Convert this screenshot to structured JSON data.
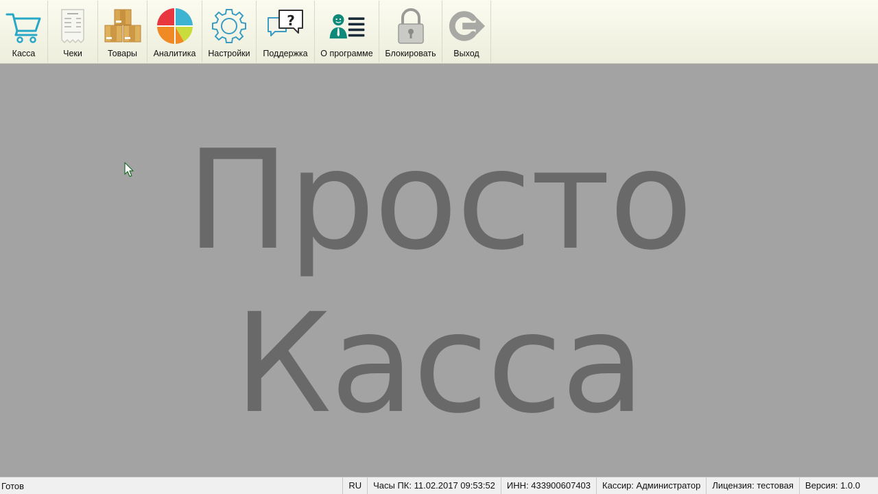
{
  "toolbar": {
    "items": [
      {
        "label": "Касса",
        "icon": "cart-icon"
      },
      {
        "label": "Чеки",
        "icon": "receipt-icon"
      },
      {
        "label": "Товары",
        "icon": "boxes-icon"
      },
      {
        "label": "Аналитика",
        "icon": "pie-chart-icon"
      },
      {
        "label": "Настройки",
        "icon": "gear-icon"
      },
      {
        "label": "Поддержка",
        "icon": "help-chat-icon"
      },
      {
        "label": "О программе",
        "icon": "user-list-icon"
      },
      {
        "label": "Блокировать",
        "icon": "lock-icon"
      },
      {
        "label": "Выход",
        "icon": "exit-icon"
      }
    ]
  },
  "splash": {
    "line1": "Просто",
    "line2": "Касса"
  },
  "status": {
    "ready": "Готов",
    "lang": "RU",
    "clock": "Часы ПК: 11.02.2017 09:53:52",
    "inn": "ИНН: 433900607403",
    "cashier": "Кассир: Администратор",
    "license": "Лицензия: тестовая",
    "version": "Версия: 1.0.0"
  },
  "colors": {
    "toolbar_bg": "#f4f4e6",
    "workspace_bg": "#a3a3a3",
    "splash_text": "#696969",
    "accent_teal": "#1aa0b8"
  }
}
